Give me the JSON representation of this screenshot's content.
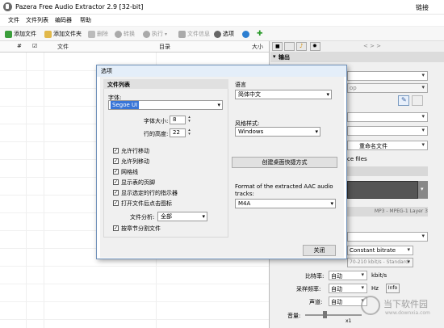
{
  "app": {
    "title": "Pazera Free Audio Extractor 2.9  [32-bit]",
    "link": "链接"
  },
  "window_buttons": {
    "minimize": "—",
    "maximize": "☐",
    "close": "✕"
  },
  "menu": [
    "文件",
    "文件列表",
    "编码器",
    "帮助"
  ],
  "toolbar": {
    "add_file": "添加文件",
    "add_folder": "添加文件夹",
    "remove": "删除",
    "convert": "转换",
    "run": "执行",
    "file_info": "文件信息",
    "options": "选项"
  },
  "file_list": {
    "columns": [
      "#",
      "☑",
      "文件",
      "目录",
      "大小"
    ]
  },
  "right_panel": {
    "nav": "< > >",
    "output_header": "输出",
    "rename_file": "重命名文件",
    "ce_files": "ce files",
    "codec_line": "MP3 - MPEG-1 Layer 3",
    "bitrate_mode": "Constant bitrate",
    "bitrate_range": "70-210 kbit/s - Standard",
    "bitrate_label": "比特率:",
    "bitrate_value": "自动",
    "bitrate_unit": "kbit/s",
    "sample_label": "采样频率:",
    "sample_value": "自动",
    "sample_unit": "Hz",
    "info_btn": "Info",
    "channels_label": "声道:",
    "channels_value": "自动",
    "volume_label": "音量:",
    "volume_value": "x1",
    "p_op": "op"
  },
  "dialog": {
    "title": "选项",
    "file_list_group": "文件列表",
    "font_label": "字体:",
    "font_value": "Segoe UI",
    "font_size_label": "字体大小:",
    "font_size_value": "8",
    "row_height_label": "行的高度:",
    "row_height_value": "22",
    "checkboxes": [
      "允许行移动",
      "允许列移动",
      "网格线",
      "显示表的页脚",
      "显示选定的行的指示器",
      "打开文件后点击图标"
    ],
    "file_analysis_label": "文件分析:",
    "file_analysis_value": "全部",
    "sort_by_chapter": "按章节分割文件",
    "language_label": "语言",
    "language_value": "简体中文",
    "style_label": "风格样式:",
    "style_value": "Windows",
    "shortcut_button": "创建桌面快捷方式",
    "aac_format_label": "Format of the extracted AAC audio tracks:",
    "aac_format_value": "M4A",
    "close_button": "关闭"
  },
  "watermark": {
    "cn": "当下软件园",
    "en": "www.downxia.com"
  }
}
